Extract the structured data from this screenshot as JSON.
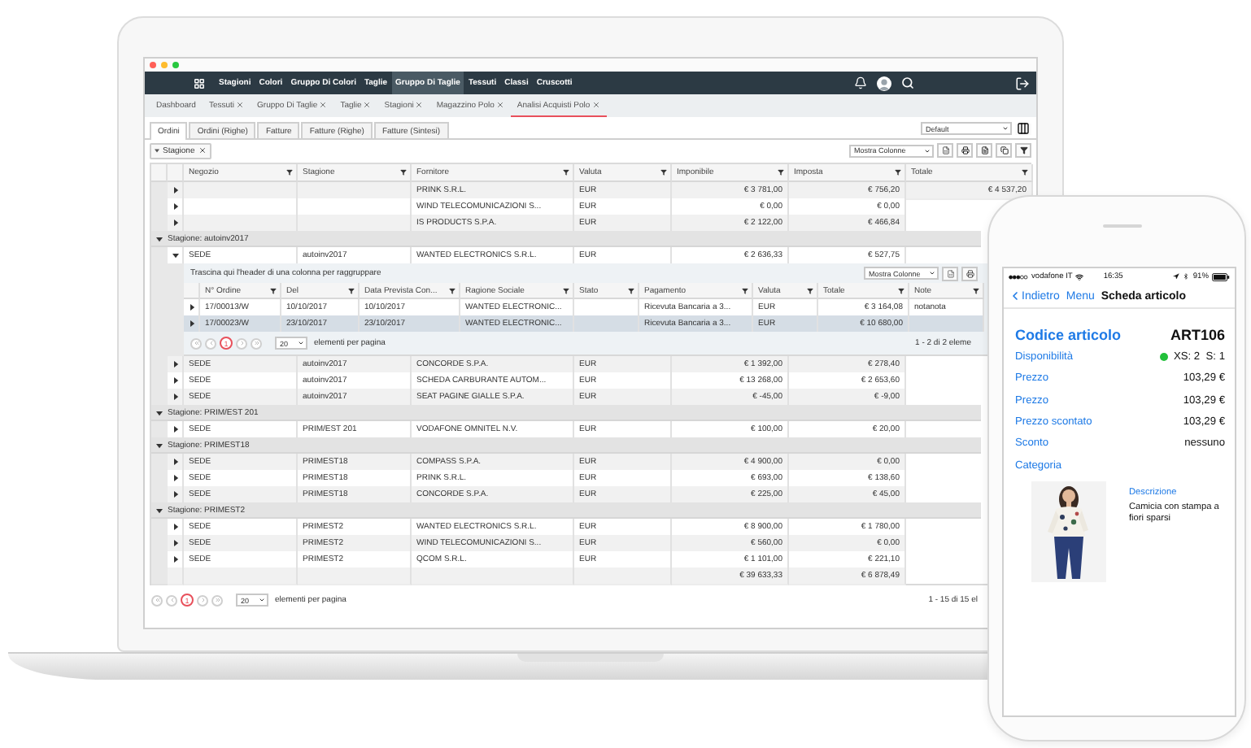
{
  "nav": {
    "items": [
      {
        "label": "Stagioni",
        "selected": false
      },
      {
        "label": "Colori",
        "selected": false
      },
      {
        "label": "Gruppo Di Colori",
        "selected": false
      },
      {
        "label": "Taglie",
        "selected": false
      },
      {
        "label": "Gruppo Di Taglie",
        "selected": true
      },
      {
        "label": "Tessuti",
        "selected": false
      },
      {
        "label": "Classi",
        "selected": false
      },
      {
        "label": "Cruscotti",
        "selected": false
      }
    ]
  },
  "tabs": [
    {
      "label": "Dashboard",
      "closable": false,
      "selected": false
    },
    {
      "label": "Tessuti",
      "closable": true,
      "selected": false
    },
    {
      "label": "Gruppo Di Taglie",
      "closable": true,
      "selected": false
    },
    {
      "label": "Taglie",
      "closable": true,
      "selected": false
    },
    {
      "label": "Stagioni",
      "closable": true,
      "selected": false
    },
    {
      "label": "Magazzino Polo",
      "closable": true,
      "selected": false
    },
    {
      "label": "Analisi Acquisti Polo",
      "closable": true,
      "selected": true
    }
  ],
  "subtabs": [
    {
      "label": "Ordini",
      "selected": true
    },
    {
      "label": "Ordini (Righe)",
      "selected": false
    },
    {
      "label": "Fatture",
      "selected": false
    },
    {
      "label": "Fatture (Righe)",
      "selected": false
    },
    {
      "label": "Fatture (Sintesi)",
      "selected": false
    }
  ],
  "layout_select": {
    "value": "Default"
  },
  "group_chip": {
    "label": "Stagione"
  },
  "columns_select": {
    "value": "Mostra Colonne"
  },
  "grid": {
    "columns": [
      "Negozio",
      "Stagione",
      "Fornitore",
      "Valuta",
      "Imponibile",
      "Imposta",
      "Totale"
    ],
    "rows": [
      {
        "kind": "row",
        "expanded": false,
        "cells": [
          null,
          null,
          "PRINK S.R.L.",
          "EUR",
          "€ 3 781,00",
          "€ 756,20",
          "€ 4 537,20"
        ]
      },
      {
        "kind": "row",
        "expanded": false,
        "cells": [
          null,
          null,
          "WIND TELECOMUNICAZIONI S...",
          "EUR",
          "€ 0,00",
          "€ 0,00",
          null
        ]
      },
      {
        "kind": "row",
        "expanded": false,
        "cells": [
          null,
          null,
          "IS PRODUCTS S.P.A.",
          "EUR",
          "€ 2 122,00",
          "€ 466,84",
          null
        ]
      },
      {
        "kind": "group",
        "expanded": true,
        "label": "Stagione: autoinv2017"
      },
      {
        "kind": "row",
        "expanded": true,
        "cells": [
          "SEDE",
          "autoinv2017",
          "WANTED ELECTRONICS S.R.L.",
          "EUR",
          "€ 2 636,33",
          "€ 527,75",
          null
        ],
        "detail": {
          "hint": "Trascina qui l'header di una colonna per raggruppare",
          "columns_select": "Mostra Colonne",
          "columns": [
            "N° Ordine",
            "Del",
            "Data Prevista Con...",
            "Ragione Sociale",
            "Stato",
            "Pagamento",
            "Valuta",
            "Totale",
            "Note"
          ],
          "rows": [
            {
              "selected": false,
              "cells": [
                "17/00013/W",
                "10/10/2017",
                "10/10/2017",
                "WANTED ELECTRONIC...",
                null,
                "Ricevuta Bancaria a 3...",
                "EUR",
                "€ 3 164,08",
                "notanota"
              ]
            },
            {
              "selected": true,
              "cells": [
                "17/00023/W",
                "23/10/2017",
                "23/10/2017",
                "WANTED ELECTRONIC...",
                null,
                "Ricevuta Bancaria a 3...",
                "EUR",
                "€ 10 680,00",
                null
              ]
            }
          ],
          "pager": {
            "page": "1",
            "page_size": "20",
            "per_page_label": "elementi per pagina",
            "summary": "1 - 2 di 2 eleme"
          }
        }
      },
      {
        "kind": "row",
        "expanded": false,
        "cells": [
          "SEDE",
          "autoinv2017",
          "CONCORDE S.P.A.",
          "EUR",
          "€ 1 392,00",
          "€ 278,40",
          null
        ]
      },
      {
        "kind": "row",
        "expanded": false,
        "cells": [
          "SEDE",
          "autoinv2017",
          "SCHEDA CARBURANTE AUTOM...",
          "EUR",
          "€ 13 268,00",
          "€ 2 653,60",
          null
        ]
      },
      {
        "kind": "row",
        "expanded": false,
        "cells": [
          "SEDE",
          "autoinv2017",
          "SEAT PAGINE GIALLE S.P.A.",
          "EUR",
          "€ -45,00",
          "€ -9,00",
          null
        ]
      },
      {
        "kind": "group",
        "expanded": true,
        "label": "Stagione: PRIM/EST 201"
      },
      {
        "kind": "row",
        "expanded": false,
        "cells": [
          "SEDE",
          "PRIM/EST 201",
          "VODAFONE OMNITEL N.V.",
          "EUR",
          "€ 100,00",
          "€ 20,00",
          null
        ]
      },
      {
        "kind": "group",
        "expanded": true,
        "label": "Stagione: PRIMEST18"
      },
      {
        "kind": "row",
        "expanded": false,
        "cells": [
          "SEDE",
          "PRIMEST18",
          "COMPASS S.P.A.",
          "EUR",
          "€ 4 900,00",
          "€ 0,00",
          null
        ]
      },
      {
        "kind": "row",
        "expanded": false,
        "cells": [
          "SEDE",
          "PRIMEST18",
          "PRINK S.R.L.",
          "EUR",
          "€ 693,00",
          "€ 138,60",
          null
        ]
      },
      {
        "kind": "row",
        "expanded": false,
        "cells": [
          "SEDE",
          "PRIMEST18",
          "CONCORDE S.P.A.",
          "EUR",
          "€ 225,00",
          "€ 45,00",
          null
        ]
      },
      {
        "kind": "group",
        "expanded": true,
        "label": "Stagione: PRIMEST2"
      },
      {
        "kind": "row",
        "expanded": false,
        "cells": [
          "SEDE",
          "PRIMEST2",
          "WANTED ELECTRONICS S.R.L.",
          "EUR",
          "€ 8 900,00",
          "€ 1 780,00",
          null
        ]
      },
      {
        "kind": "row",
        "expanded": false,
        "cells": [
          "SEDE",
          "PRIMEST2",
          "WIND TELECOMUNICAZIONI S...",
          "EUR",
          "€ 560,00",
          "€ 0,00",
          null
        ]
      },
      {
        "kind": "row",
        "expanded": false,
        "cells": [
          "SEDE",
          "PRIMEST2",
          "QCOM S.R.L.",
          "EUR",
          "€ 1 101,00",
          "€ 221,10",
          null
        ]
      }
    ],
    "footer": {
      "imponibile": "€ 39 633,33",
      "imposta": "€ 6 878,49"
    },
    "pager": {
      "page": "1",
      "page_size": "20",
      "per_page_label": "elementi per pagina",
      "summary": "1 - 15 di 15 el"
    }
  },
  "phone": {
    "status": {
      "carrier": "vodafone IT",
      "time": "16:35",
      "battery": "91%"
    },
    "navbar": {
      "back": "Indietro",
      "menu": "Menu",
      "title": "Scheda articolo"
    },
    "header": {
      "label": "Codice articolo",
      "value": "ART106"
    },
    "fields": [
      {
        "label": "Disponibilità",
        "value": "XS: 2  S: 1",
        "color": "#22c03a"
      },
      {
        "label": "Prezzo",
        "value": "103,29 €"
      },
      {
        "label": "Prezzo",
        "value": "103,29 €"
      },
      {
        "label": "Prezzo scontato",
        "value": "103,29 €"
      },
      {
        "label": "Sconto",
        "value": "nessuno"
      },
      {
        "label": "Categoria"
      }
    ],
    "product": {
      "kind": "picture",
      "label": "Descrizione",
      "text": "Camicia con stampa a fiori sparsi"
    }
  }
}
